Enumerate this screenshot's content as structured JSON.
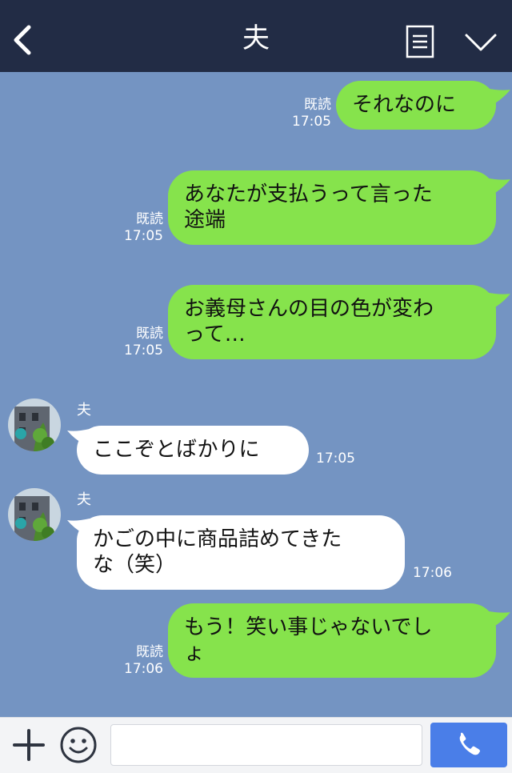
{
  "header": {
    "title": "夫",
    "back_icon": "chevron-left-icon",
    "menu_icon": "memo-list-icon",
    "collapse_icon": "chevron-down-icon"
  },
  "messages": [
    {
      "direction": "out",
      "lines": [
        "それなのに"
      ],
      "read": "既読",
      "time": "17:05"
    },
    {
      "direction": "out",
      "lines": [
        "あなたが支払うって言った",
        "途端"
      ],
      "read": "既読",
      "time": "17:05"
    },
    {
      "direction": "out",
      "lines": [
        "お義母さんの目の色が変わ",
        "って…"
      ],
      "read": "既読",
      "time": "17:05"
    },
    {
      "direction": "in",
      "sender": "夫",
      "lines": [
        "ここぞとばかりに"
      ],
      "time": "17:05"
    },
    {
      "direction": "in",
      "sender": "夫",
      "lines": [
        "かごの中に商品詰めてきた",
        "な（笑）"
      ],
      "time": "17:06"
    },
    {
      "direction": "out",
      "lines": [
        "もう！笑い事じゃないでし",
        "ょ"
      ],
      "read": "既読",
      "time": "17:06"
    }
  ],
  "footer": {
    "input_value": "",
    "plus_icon": "plus-icon",
    "emoji_icon": "smiley-icon",
    "call_icon": "phone-icon"
  },
  "colors": {
    "header_bg": "#222c45",
    "chat_bg": "#7494c2",
    "outgoing_bubble": "#86e34c",
    "incoming_bubble": "#ffffff",
    "call_button": "#4a7ee8"
  }
}
